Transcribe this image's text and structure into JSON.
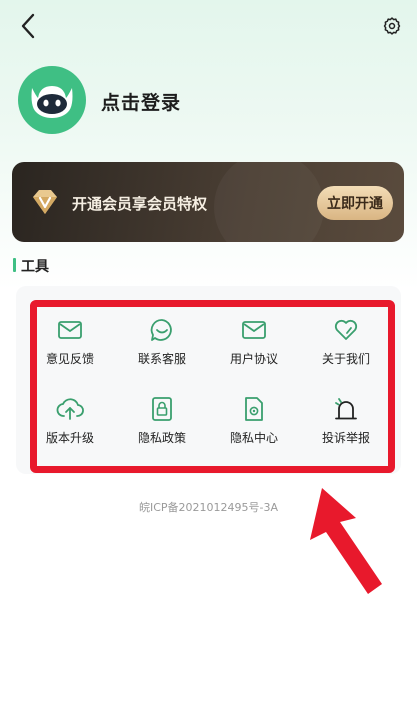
{
  "header": {
    "back_icon": "chevron-left-icon",
    "settings_icon": "gear-icon"
  },
  "profile": {
    "login_label": "点击登录",
    "avatar_color": "#3fbf84"
  },
  "vip": {
    "text": "开通会员享会员特权",
    "button_label": "立即开通"
  },
  "tools": {
    "title": "工具",
    "items": [
      {
        "label": "意见反馈",
        "icon": "mail-icon"
      },
      {
        "label": "联系客服",
        "icon": "chat-icon"
      },
      {
        "label": "用户协议",
        "icon": "document-icon"
      },
      {
        "label": "关于我们",
        "icon": "heart-icon"
      },
      {
        "label": "版本升级",
        "icon": "cloud-upload-icon"
      },
      {
        "label": "隐私政策",
        "icon": "lock-icon"
      },
      {
        "label": "隐私中心",
        "icon": "gear-doc-icon"
      },
      {
        "label": "投诉举报",
        "icon": "alarm-icon"
      }
    ]
  },
  "footer": {
    "icp": "皖ICP备2021012495号-3A"
  },
  "colors": {
    "accent": "#3fbf84",
    "highlight": "#e8192c",
    "vip_gold": "#d9b583"
  }
}
